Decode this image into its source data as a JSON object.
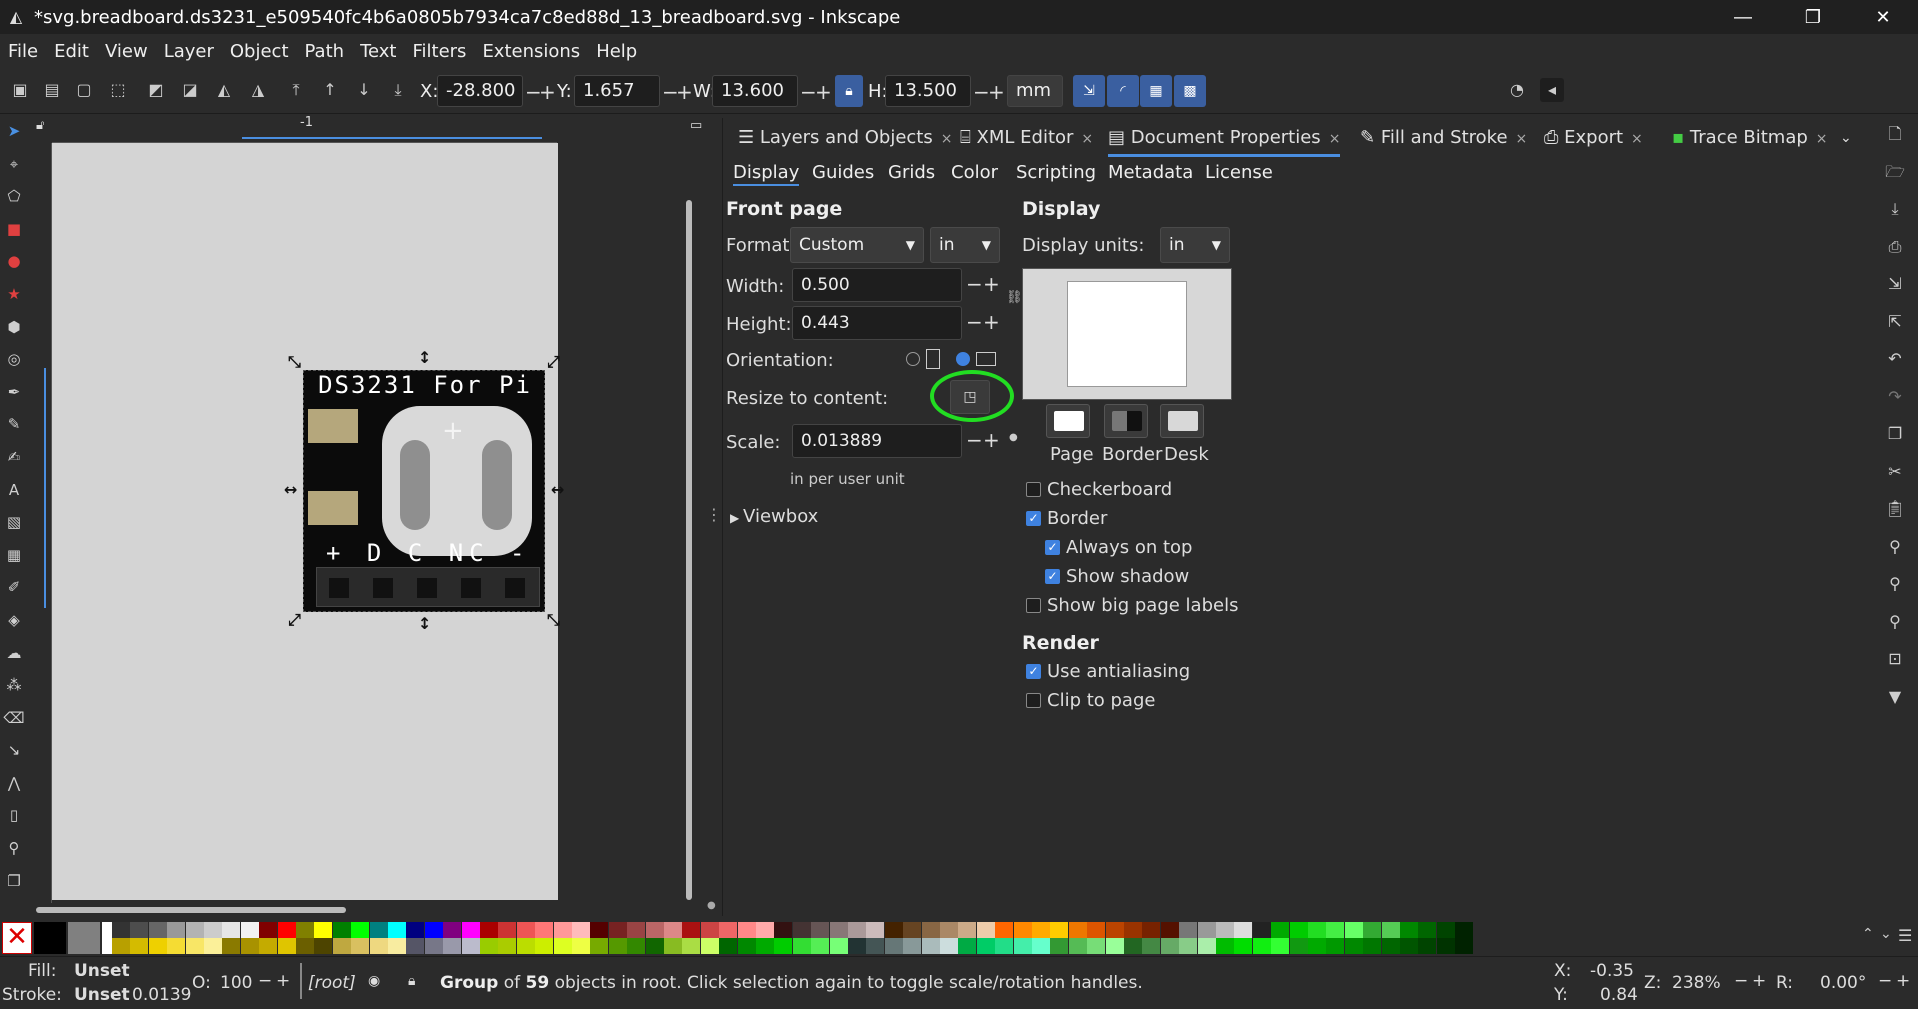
{
  "window": {
    "title": "*svg.breadboard.ds3231_e509540fc4b6a0805b7934ca7c8ed88d_13_breadboard.svg - Inkscape"
  },
  "menu": [
    "File",
    "Edit",
    "View",
    "Layer",
    "Object",
    "Path",
    "Text",
    "Filters",
    "Extensions",
    "Help"
  ],
  "toolbar": {
    "x_label": "X:",
    "x_value": "-28.800",
    "y_label": "Y:",
    "y_value": "1.657",
    "w_label": "W:",
    "w_value": "13.600",
    "h_label": "H:",
    "h_value": "13.500",
    "unit": "mm",
    "minus": "−",
    "plus": "+"
  },
  "canvas": {
    "ruler_mark": "-1",
    "pcb_title": "DS3231 For Pi",
    "pin_labels": "+ D C NC -"
  },
  "dock": {
    "tabs": [
      {
        "label": "Layers and Objects"
      },
      {
        "label": "XML Editor"
      },
      {
        "label": "Document Properties"
      },
      {
        "label": "Fill and Stroke"
      },
      {
        "label": "Export"
      },
      {
        "label": "Trace Bitmap"
      }
    ],
    "tab_close": "×",
    "subtabs": [
      "Display",
      "Guides",
      "Grids",
      "Color",
      "Scripting",
      "Metadata",
      "License"
    ],
    "front_page": {
      "title": "Front page",
      "format_label": "Format:",
      "format_value": "Custom",
      "format_unit": "in",
      "width_label": "Width:",
      "width_value": "0.500",
      "height_label": "Height:",
      "height_value": "0.443",
      "orientation_label": "Orientation:",
      "resize_label": "Resize to content:",
      "scale_label": "Scale:",
      "scale_value": "0.013889",
      "scale_hint": "in per user unit",
      "viewbox_label": "Viewbox"
    },
    "display": {
      "title": "Display",
      "units_label": "Display units:",
      "units_value": "in",
      "swatch_page": "Page",
      "swatch_border": "Border",
      "swatch_desk": "Desk",
      "checkboxes": [
        {
          "label": "Checkerboard",
          "checked": false
        },
        {
          "label": "Border",
          "checked": true
        },
        {
          "label": "Always on top",
          "checked": true
        },
        {
          "label": "Show shadow",
          "checked": true
        },
        {
          "label": "Show big page labels",
          "checked": false
        }
      ],
      "render_title": "Render",
      "render_checkboxes": [
        {
          "label": "Use antialiasing",
          "checked": true
        },
        {
          "label": "Clip to page",
          "checked": false
        }
      ]
    }
  },
  "status": {
    "fill_label": "Fill:",
    "fill_value": "Unset",
    "stroke_label": "Stroke:",
    "stroke_value": "Unset",
    "stroke_width": "0.0139",
    "opacity_label": "O:",
    "opacity_value": "100",
    "layer": "[root]",
    "message_bold": "Group",
    "message_of": "of",
    "message_count": "59",
    "message_rest": "objects in root. Click selection again to toggle scale/rotation handles.",
    "cursor_x_label": "X:",
    "cursor_x": "-0.35",
    "cursor_y_label": "Y:",
    "cursor_y": "0.84",
    "zoom_label": "Z:",
    "zoom": "238%",
    "rotation_label": "R:",
    "rotation": "0.00°"
  }
}
